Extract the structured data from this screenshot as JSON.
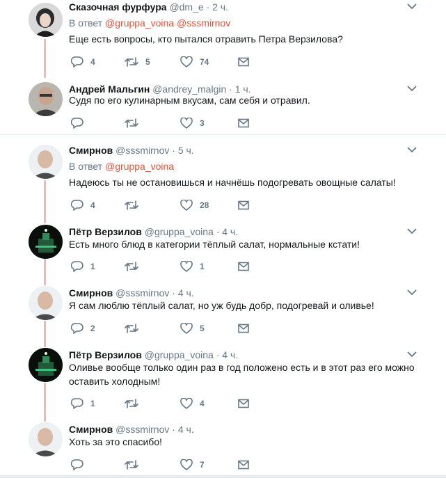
{
  "tweets": [
    {
      "name": "Сказочная фурфура",
      "handle": "@dm_e",
      "time": "2 ч.",
      "reply_prefix": "В ответ",
      "reply_to": [
        "@gruppa_voina",
        "@sssmirnov"
      ],
      "text": "Еще есть вопросы, кто пытался отравить Петра Верзилова?",
      "reply_count": "4",
      "retweet_count": "5",
      "like_count": "74"
    },
    {
      "name": "Андрей Мальгин",
      "handle": "@andrey_malgin",
      "time": "1 ч.",
      "text": "Судя по его кулинарным вкусам, сам себя и отравил.",
      "reply_count": "",
      "retweet_count": "",
      "like_count": "3"
    },
    {
      "name": "Смирнов",
      "handle": "@sssmirnov",
      "time": "5 ч.",
      "reply_prefix": "В ответ",
      "reply_to": [
        "@gruppa_voina"
      ],
      "text": "Надеюсь ты не остановишься и начнёшь подогревать овощные салаты!",
      "reply_count": "4",
      "retweet_count": "",
      "like_count": "28"
    },
    {
      "name": "Пётр Верзилов",
      "handle": "@gruppa_voina",
      "time": "4 ч.",
      "text": "Есть много блюд в категории тёплый салат, нормальные кстати!",
      "reply_count": "1",
      "retweet_count": "",
      "like_count": "1"
    },
    {
      "name": "Смирнов",
      "handle": "@sssmirnov",
      "time": "4 ч.",
      "text": "Я сам люблю тёплый салат, но уж будь добр, подогревай и оливье!",
      "reply_count": "2",
      "retweet_count": "",
      "like_count": "5"
    },
    {
      "name": "Пётр Верзилов",
      "handle": "@gruppa_voina",
      "time": "4 ч.",
      "text": "Оливье вообще только один раз в год положено есть и в этот раз его можно оставить холодным!",
      "reply_count": "1",
      "retweet_count": "",
      "like_count": "4"
    },
    {
      "name": "Смирнов",
      "handle": "@sssmirnov",
      "time": "4 ч.",
      "text": "Хоть за это спасибо!",
      "reply_count": "",
      "retweet_count": "",
      "like_count": "7"
    }
  ],
  "separator": "·",
  "colors": {
    "accent": "#e0533a",
    "thread_line": "#f5b5b5",
    "muted": "#657786"
  },
  "icons": [
    "reply-icon",
    "retweet-icon",
    "like-icon",
    "message-icon",
    "chevron-down-icon"
  ]
}
